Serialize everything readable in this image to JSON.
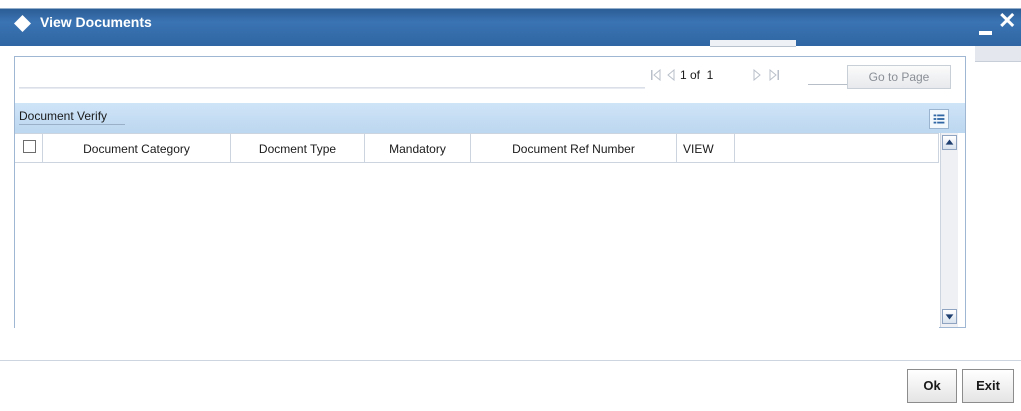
{
  "window": {
    "title": "View Documents",
    "minimize_label": "–",
    "close_label": "✕"
  },
  "pager": {
    "status_text": "1 of  1",
    "page_input_value": "",
    "goto_label": "Go to Page"
  },
  "grid": {
    "title": "Document Verify",
    "columns": [
      {
        "label": "Document Category"
      },
      {
        "label": "Docment Type"
      },
      {
        "label": "Mandatory"
      },
      {
        "label": "Document Ref Number"
      },
      {
        "label": "VIEW"
      }
    ],
    "rows": []
  },
  "footer": {
    "ok_label": "Ok",
    "exit_label": "Exit"
  },
  "colors": {
    "title_bar": "#3b74b3",
    "grid_header": "#cfe4f7",
    "panel_border": "#9fb7d2"
  },
  "icons": [
    "logo-diamond-icon",
    "first-page-icon",
    "previous-page-icon",
    "next-page-icon",
    "last-page-icon",
    "grid-options-icon",
    "scroll-up-icon",
    "scroll-down-icon"
  ]
}
